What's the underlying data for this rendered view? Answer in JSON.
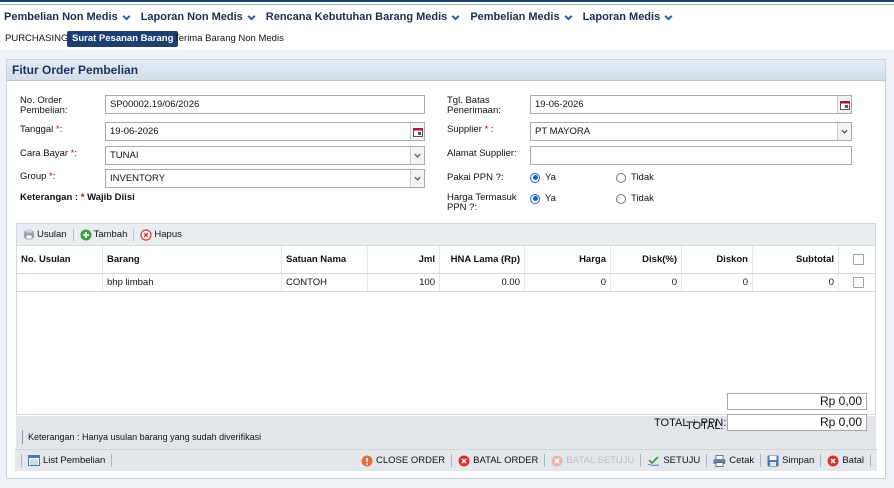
{
  "menu": [
    {
      "label": "Pembelian Non Medis"
    },
    {
      "label": "Laporan Non Medis"
    },
    {
      "label": "Rencana Kebutuhan Barang Medis"
    },
    {
      "label": "Pembelian Medis"
    },
    {
      "label": "Laporan Medis"
    }
  ],
  "subnav": {
    "home": "PURCHASING",
    "active": "Surat Pesanan Barang",
    "other": "Terima Barang Non Medis"
  },
  "panel": {
    "title": "Fitur Order Pembelian"
  },
  "form": {
    "no_order_label_1": "No. Order",
    "no_order_label_2": "Pembelian:",
    "no_order_value": "SP00002.19/06/2026",
    "tanggal_label": "Tanggal",
    "tanggal_suffix": ":",
    "tanggal_value": "19-06-2026",
    "cara_bayar_label": "Cara Bayar",
    "cara_bayar_suffix": ":",
    "cara_bayar_value": "TUNAI",
    "group_label": "Group",
    "group_suffix": ":",
    "group_value": "INVENTORY",
    "required_mark": "*",
    "keterangan_prefix": "Keterangan :",
    "keterangan_star": "*",
    "keterangan_text": "Wajib Diisi",
    "tgl_batas_label_1": "Tgl. Batas",
    "tgl_batas_label_2": "Penerimaan:",
    "tgl_batas_value": "19-06-2026",
    "supplier_label": "Supplier",
    "supplier_suffix": " :",
    "supplier_value": "PT MAYORA",
    "alamat_label": "Alamat Supplier:",
    "alamat_value": "",
    "ppn_label": "Pakai PPN ?:",
    "ppn_yes": "Ya",
    "ppn_no": "Tidak",
    "harga_ppn_label_1": "Harga Termasuk",
    "harga_ppn_label_2": "PPN ?:",
    "harga_ppn_yes": "Ya",
    "harga_ppn_no": "Tidak"
  },
  "grid_toolbar": {
    "usulan": "Usulan",
    "tambah": "Tambah",
    "hapus": "Hapus"
  },
  "grid": {
    "columns": [
      "No. Usulan",
      "Barang",
      "Satuan Nama",
      "Jml",
      "HNA Lama (Rp)",
      "Harga",
      "Disk(%)",
      "Diskon",
      "Subtotal"
    ],
    "rows": [
      {
        "no_usulan": "",
        "barang": "bhp limbah",
        "satuan": "CONTOH",
        "jml": "100",
        "hna_lama": "0.00",
        "harga": "0",
        "disk": "0",
        "diskon": "0",
        "subtotal": "0"
      }
    ]
  },
  "totals": {
    "total_label": "TOTAL:",
    "total_value": "Rp 0,00",
    "total_ppn_label": "TOTAL + PPN:",
    "total_ppn_value": "Rp 0,00"
  },
  "note": "Keterangan : Hanya usulan barang yang sudah diverifikasi",
  "bottom": {
    "list": "List Pembelian",
    "close_order": "CLOSE ORDER",
    "batal_order": "BATAL ORDER",
    "batal_setuju": "BATAL SETUJU",
    "setuju": "SETUJU",
    "cetak": "Cetak",
    "simpan": "Simpan",
    "batal": "Batal"
  },
  "colors": {
    "nav": "#1d3f72",
    "danger": "#d9342b",
    "success": "#3aa23a"
  }
}
